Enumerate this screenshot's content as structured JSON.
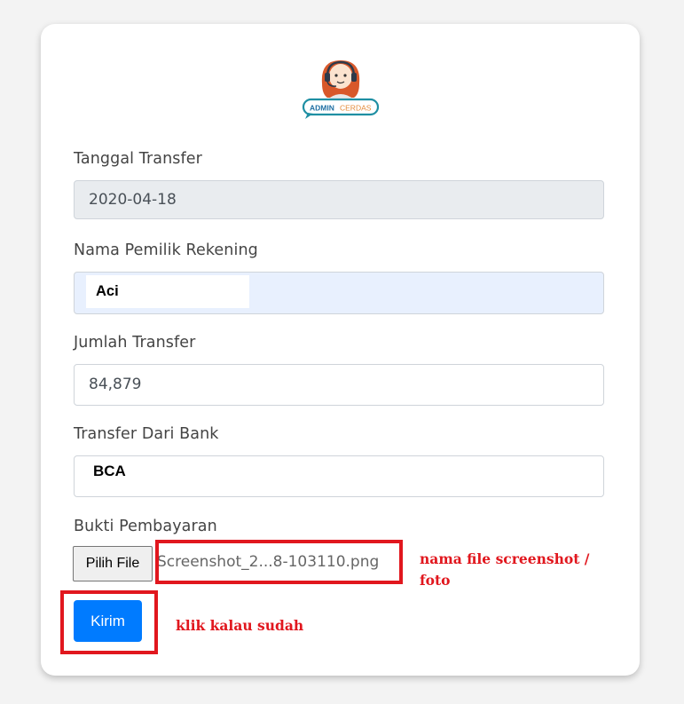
{
  "logo": {
    "text_left": "ADMIN",
    "text_right": "CERDAS"
  },
  "form": {
    "tanggal_label": "Tanggal Transfer",
    "tanggal_value": "2020-04-18",
    "nama_label": "Nama Pemilik Rekening",
    "nama_value": "Aci",
    "jumlah_label": "Jumlah Transfer",
    "jumlah_value": "84,879",
    "bank_label": "Transfer Dari Bank",
    "bank_value": "BCA",
    "bukti_label": "Bukti Pembayaran",
    "file_button": "Pilih File",
    "file_name": "Screenshot_2...8-103110.png",
    "submit_label": "Kirim"
  },
  "annotations": {
    "file_note_line1": "nama file screenshot /",
    "file_note_line2": "foto",
    "submit_note": "klik kalau sudah",
    "highlight_color": "#e1171e"
  },
  "colors": {
    "primary": "#007bff",
    "readonly_bg": "#e9ecef",
    "autofill_bg": "#e8f0fe"
  }
}
